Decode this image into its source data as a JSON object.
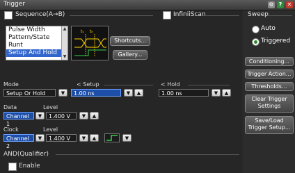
{
  "window": {
    "title": "Trigger"
  },
  "sequence": {
    "label": "Sequence(A→B)"
  },
  "infiniiscan": {
    "label": "InfiniiScan"
  },
  "trigger_types": {
    "items": [
      "Pulse Width",
      "Pattern/State",
      "Runt",
      "Setup And Hold"
    ],
    "selected": "Setup And Hold"
  },
  "diagram": {
    "t_s": "tₛ",
    "t_h": "tₕ"
  },
  "buttons": {
    "shortcuts": "Shortcuts...",
    "gallery": "Gallery..."
  },
  "mode": {
    "label": "Mode",
    "value": "Setup Or Hold"
  },
  "setup": {
    "label": "< Setup",
    "value": "1.00 ns"
  },
  "hold": {
    "label": "< Hold",
    "value": "1.00 ns"
  },
  "data": {
    "label": "Data",
    "level_label": "Level",
    "channel": "Channel 1",
    "level": "1.400 V"
  },
  "clock": {
    "label": "Clock",
    "level_label": "Level",
    "channel": "Channel 2",
    "level": "1.400 V"
  },
  "qualifier": {
    "label": "AND(Qualifier)",
    "enable": "Enable"
  },
  "sweep": {
    "title": "Sweep",
    "auto": "Auto",
    "triggered": "Triggered",
    "selected": "Triggered"
  },
  "side_buttons": {
    "conditioning": "Conditioning...",
    "trigger_action": "Trigger Action...",
    "thresholds": "Thresholds...",
    "clear_1": "Clear Trigger",
    "clear_2": "Settings",
    "saveload_1": "Save/Load",
    "saveload_2": "Trigger Setup..."
  },
  "colors": {
    "selected_field": "#1e4fa8",
    "list_selection": "#3366cc",
    "radio_on": "#2a8a2a"
  }
}
